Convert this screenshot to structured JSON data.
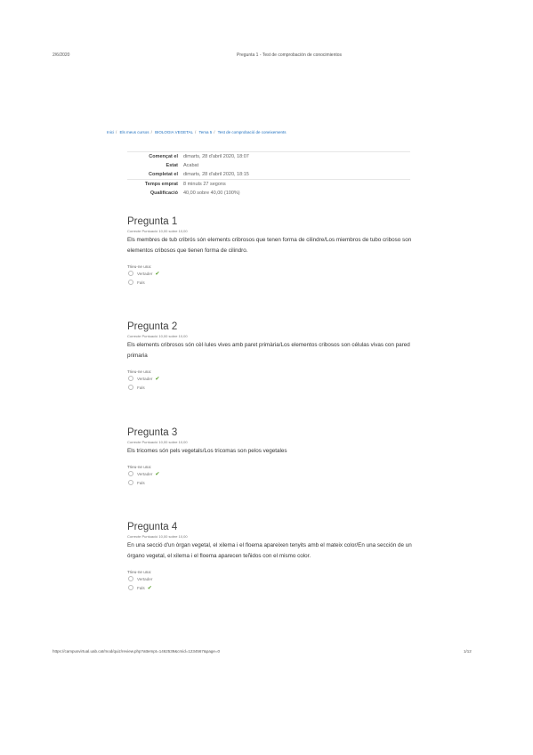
{
  "header": {
    "date": "2/6/2020",
    "title": "Pregunta 1 - Test de comprobación de conocimientos"
  },
  "breadcrumb": [
    "Inici",
    "Els meus cursos",
    "BIOLOGIA VEGETAL",
    "Tema 5",
    "Test de comprobació de coneixements"
  ],
  "summary": [
    {
      "label": "Començat el",
      "value": "dimarts, 28 d'abril 2020, 18:07"
    },
    {
      "label": "Estat",
      "value": "Acabat"
    },
    {
      "label": "Completat el",
      "value": "dimarts, 28 d'abril 2020, 18:15"
    },
    {
      "label": "Temps emprat",
      "value": "8 minuts 27 segons"
    },
    {
      "label": "Qualificació",
      "value": "40,00 sobre 40,00 (100%)"
    }
  ],
  "questions": [
    {
      "title": "Pregunta 1",
      "meta": "Correcte    Puntuació 10,00 sobre 10,00",
      "text": "Els membres de tub cribrós són elements cribrosos que tenen forma de cilindre/Los miembros de tubo criboso son elementos cribosos que tienen forma de cilindro.",
      "choose": "Trieu-ne una:",
      "options": [
        "Vertader",
        "Fals"
      ],
      "selected": 0
    },
    {
      "title": "Pregunta 2",
      "meta": "Correcte    Puntuació 10,00 sobre 10,00",
      "text": "Els elements cribrosos són cèl·lules vives amb paret primària/Los elementos cribosos son células vivas con pared primaria",
      "choose": "Trieu-ne una:",
      "options": [
        "Vertader",
        "Fals"
      ],
      "selected": 0
    },
    {
      "title": "Pregunta 3",
      "meta": "Correcte    Puntuació 10,00 sobre 10,00",
      "text": "Els tricomes són pels vegetals/Los tricomas son pelos vegetales",
      "choose": "Trieu-ne una:",
      "options": [
        "Vertader",
        "Fals"
      ],
      "selected": 0
    },
    {
      "title": "Pregunta 4",
      "meta": "Correcte    Puntuació 10,00 sobre 10,00",
      "text": "En una secció d'un òrgan vegetal, el xilema i el floema apareixen tenyits amb el mateix color/En una sección de un órgano vegetal, el xilema i el floema aparecen teñidos con el mismo color.",
      "choose": "Trieu-ne una:",
      "options": [
        "Vertader",
        "Fals"
      ],
      "selected": 1
    }
  ],
  "footer": {
    "url": "https://campusvirtual.uab.cat/mod/quiz/review.php?attempt=1462539&cmid=1234567&page=0",
    "page": "1/12"
  },
  "colors": {
    "link": "#1e6fbf",
    "correct": "#5aa02c"
  }
}
